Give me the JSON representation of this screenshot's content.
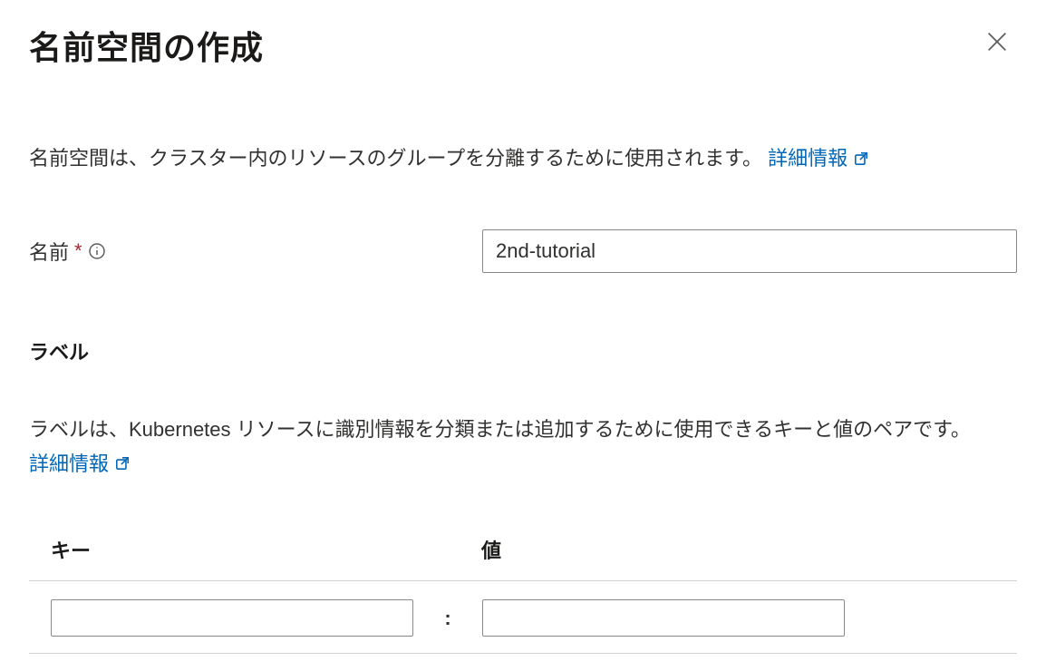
{
  "header": {
    "title": "名前空間の作成"
  },
  "namespace": {
    "description": "名前空間は、クラスター内のリソースのグループを分離するために使用されます。",
    "learn_more": "詳細情報",
    "name_label": "名前",
    "name_value": "2nd-tutorial"
  },
  "labels": {
    "heading": "ラベル",
    "description": "ラベルは、Kubernetes リソースに識別情報を分類または追加するために使用できるキーと値のペアです。",
    "learn_more": "詳細情報",
    "key_header": "キー",
    "value_header": "値",
    "colon": ":",
    "rows": [
      {
        "key": "",
        "value": ""
      }
    ]
  }
}
